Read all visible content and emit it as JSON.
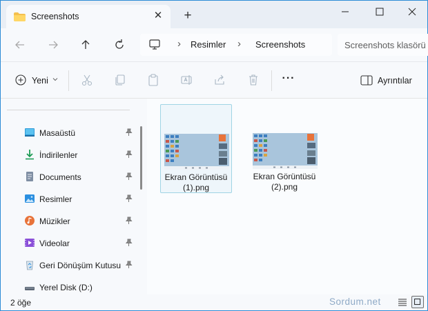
{
  "tab": {
    "title": "Screenshots"
  },
  "breadcrumb": [
    "Resimler",
    "Screenshots"
  ],
  "search": {
    "placeholder": "Screenshots klasörü"
  },
  "toolbar": {
    "new_label": "Yeni",
    "details_label": "Ayrıntılar",
    "more_label": "···"
  },
  "sidebar": {
    "items": [
      {
        "label": "Masaüstü",
        "icon": "desktop-icon",
        "pinned": true
      },
      {
        "label": "İndirilenler",
        "icon": "download-icon",
        "pinned": true
      },
      {
        "label": "Documents",
        "icon": "documents-icon",
        "pinned": true
      },
      {
        "label": "Resimler",
        "icon": "pictures-icon",
        "pinned": true
      },
      {
        "label": "Müzikler",
        "icon": "music-icon",
        "pinned": true
      },
      {
        "label": "Videolar",
        "icon": "videos-icon",
        "pinned": true
      },
      {
        "label": "Geri Dönüşüm Kutusu",
        "icon": "recycle-bin-icon",
        "pinned": true
      },
      {
        "label": "Yerel Disk (D:)",
        "icon": "drive-icon",
        "pinned": false
      }
    ]
  },
  "files": [
    {
      "name": "Ekran Görüntüsü (1).png",
      "line1": "Ekran Görüntüsü",
      "line2": "(1).png",
      "selected": true
    },
    {
      "name": "Ekran Görüntüsü (2).png",
      "line1": "Ekran Görüntüsü",
      "line2": "(2).png",
      "selected": false
    }
  ],
  "status": {
    "count": "2 öğe"
  },
  "watermark": "Sordum.net",
  "colors": {
    "accent": "#0067c0",
    "window_border": "#2c8bd6",
    "selection": "#eef6fb"
  }
}
